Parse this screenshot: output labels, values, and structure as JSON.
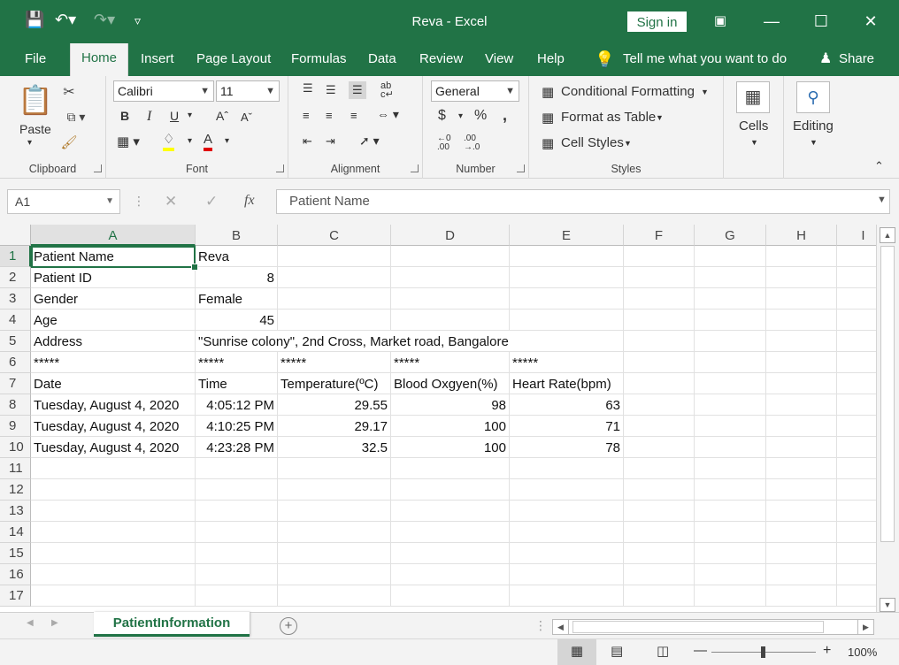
{
  "window": {
    "title": "Reva  -  Excel",
    "sign_in": "Sign in"
  },
  "tabs": [
    "File",
    "Home",
    "Insert",
    "Page Layout",
    "Formulas",
    "Data",
    "Review",
    "View",
    "Help"
  ],
  "tell_me": "Tell me what you want to do",
  "share": "Share",
  "ribbon": {
    "clipboard": {
      "label": "Clipboard",
      "paste": "Paste"
    },
    "font": {
      "label": "Font",
      "name": "Calibri",
      "size": "11",
      "bold": "B",
      "italic": "I",
      "underline": "U"
    },
    "alignment": {
      "label": "Alignment"
    },
    "number": {
      "label": "Number",
      "format": "General",
      "currency": "$",
      "percent": "%",
      "comma": ","
    },
    "styles": {
      "label": "Styles",
      "conditional": "Conditional Formatting",
      "format_table": "Format as Table",
      "cell_styles": "Cell Styles"
    },
    "cells": {
      "label": "Cells"
    },
    "editing": {
      "label": "Editing"
    }
  },
  "formula_bar": {
    "name_box": "A1",
    "fx": "fx",
    "value": "Patient Name"
  },
  "columns": [
    "A",
    "B",
    "C",
    "D",
    "E",
    "F",
    "G",
    "H",
    "I"
  ],
  "rows": [
    "1",
    "2",
    "3",
    "4",
    "5",
    "6",
    "7",
    "8",
    "9",
    "10",
    "11",
    "12",
    "13",
    "14",
    "15",
    "16",
    "17"
  ],
  "cells": {
    "A1": "Patient Name",
    "B1": "Reva",
    "A2": "Patient ID",
    "B2": "8",
    "A3": "Gender",
    "B3": "Female",
    "A4": "Age",
    "B4": "45",
    "A5": "Address",
    "B5": "\"Sunrise colony\", 2nd Cross, Market road, Bangalore",
    "A6": "*****",
    "B6": "*****",
    "C6": "*****",
    "D6": "*****",
    "E6": "*****",
    "A7": "Date",
    "B7": "Time",
    "C7": "Temperature(ºC)",
    "D7": "Blood Oxgyen(%)",
    "E7": "Heart Rate(bpm)",
    "A8": "Tuesday, August 4, 2020",
    "B8": "4:05:12 PM",
    "C8": "29.55",
    "D8": "98",
    "E8": "63",
    "A9": "Tuesday, August 4, 2020",
    "B9": "4:10:25 PM",
    "C9": "29.17",
    "D9": "100",
    "E9": "71",
    "A10": "Tuesday, August 4, 2020",
    "B10": "4:23:28 PM",
    "C10": "32.5",
    "D10": "100",
    "E10": "78"
  },
  "sheet_tab": "PatientInformation",
  "status": {
    "zoom": "100%"
  },
  "colors": {
    "accent": "#217346"
  }
}
